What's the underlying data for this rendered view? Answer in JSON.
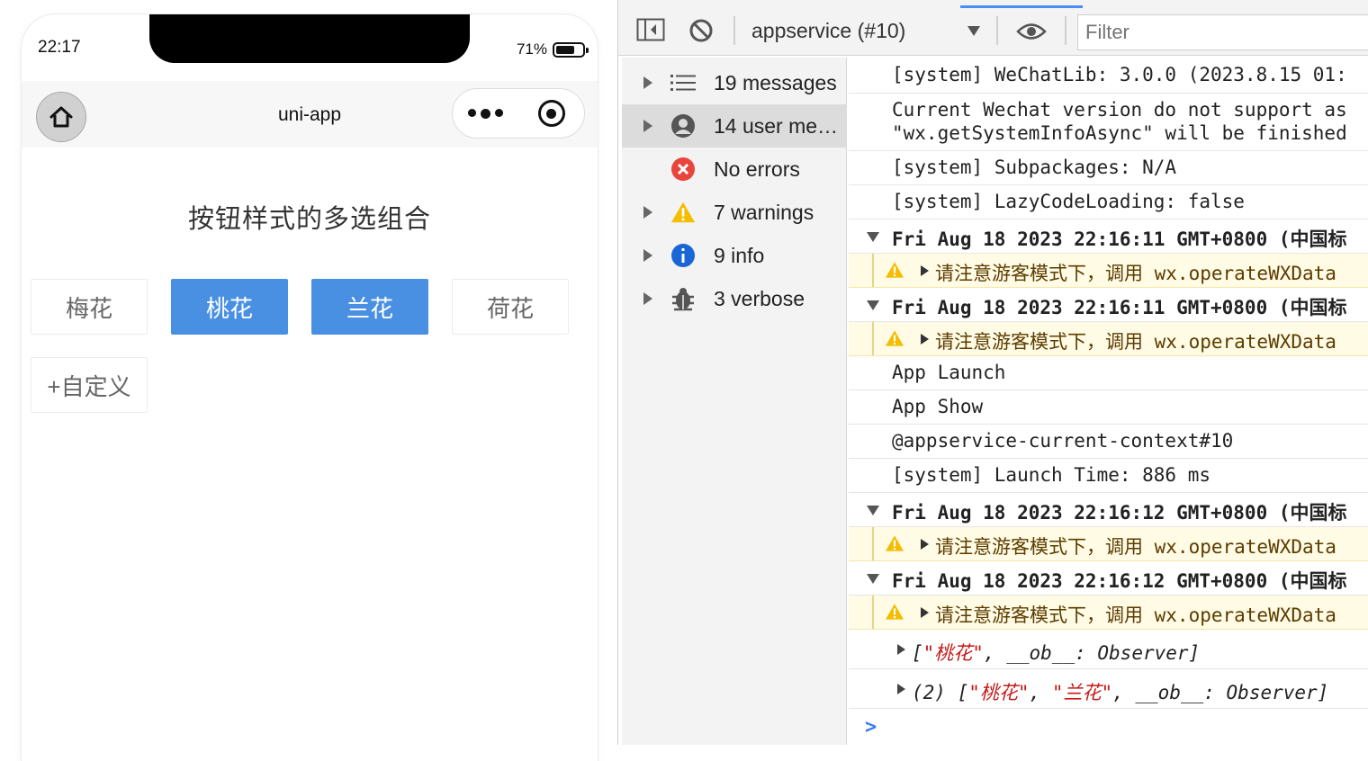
{
  "phone": {
    "status": {
      "time": "22:17",
      "battery": "71%",
      "battery_level": 0.71
    },
    "nav": {
      "title": "uni-app"
    },
    "content": {
      "title": "按钮样式的多选组合",
      "options": [
        {
          "label": "梅花",
          "selected": false
        },
        {
          "label": "桃花",
          "selected": true
        },
        {
          "label": "兰花",
          "selected": true
        },
        {
          "label": "荷花",
          "selected": false
        }
      ],
      "custom_label": "+自定义"
    }
  },
  "devtools": {
    "toolbar": {
      "context": "appservice (#10)",
      "filter_placeholder": "Filter"
    },
    "sidebar": [
      {
        "label": "19 messages",
        "icon": "list-icon",
        "arrow": true,
        "selected": false
      },
      {
        "label": "14 user me…",
        "icon": "user-icon",
        "arrow": true,
        "selected": true
      },
      {
        "label": "No errors",
        "icon": "error-icon",
        "arrow": false,
        "selected": false
      },
      {
        "label": "7 warnings",
        "icon": "warning-icon",
        "arrow": true,
        "selected": false
      },
      {
        "label": "9 info",
        "icon": "info-icon",
        "arrow": true,
        "selected": false
      },
      {
        "label": "3 verbose",
        "icon": "bug-icon",
        "arrow": true,
        "selected": false
      }
    ],
    "console": {
      "lines": [
        "[system] WeChatLib: 3.0.0 (2023.8.15 01:",
        "Current Wechat version do not support as",
        "\"wx.getSystemInfoAsync\" will be finished",
        "[system] Subpackages: N/A",
        "[system] LazyCodeLoading: false",
        "Fri Aug 18 2023 22:16:11 GMT+0800 (中国标",
        "请注意游客模式下，调用 wx.operateWXData",
        "Fri Aug 18 2023 22:16:11 GMT+0800 (中国标",
        "请注意游客模式下，调用 wx.operateWXData",
        "App Launch",
        "App Show",
        "@appservice-current-context#10",
        "[system] Launch Time: 886 ms",
        "Fri Aug 18 2023 22:16:12 GMT+0800 (中国标",
        "请注意游客模式下，调用 wx.operateWXData",
        "Fri Aug 18 2023 22:16:12 GMT+0800 (中国标",
        "请注意游客模式下，调用 wx.operateWXData"
      ],
      "obj1": {
        "open": "[",
        "s1": "\"桃花\"",
        "rest": ", __ob__: Observer]"
      },
      "obj2": {
        "open": "(2) [",
        "s1": "\"桃花\"",
        "sep": ", ",
        "s2": "\"兰花\"",
        "rest": ", __ob__: Observer]"
      },
      "prompt": ">"
    }
  },
  "colors": {
    "accent": "#4a90e2",
    "warning_bg": "#fffbe5",
    "string": "#c41a16",
    "devtools_blue": "#4a8cf7"
  }
}
